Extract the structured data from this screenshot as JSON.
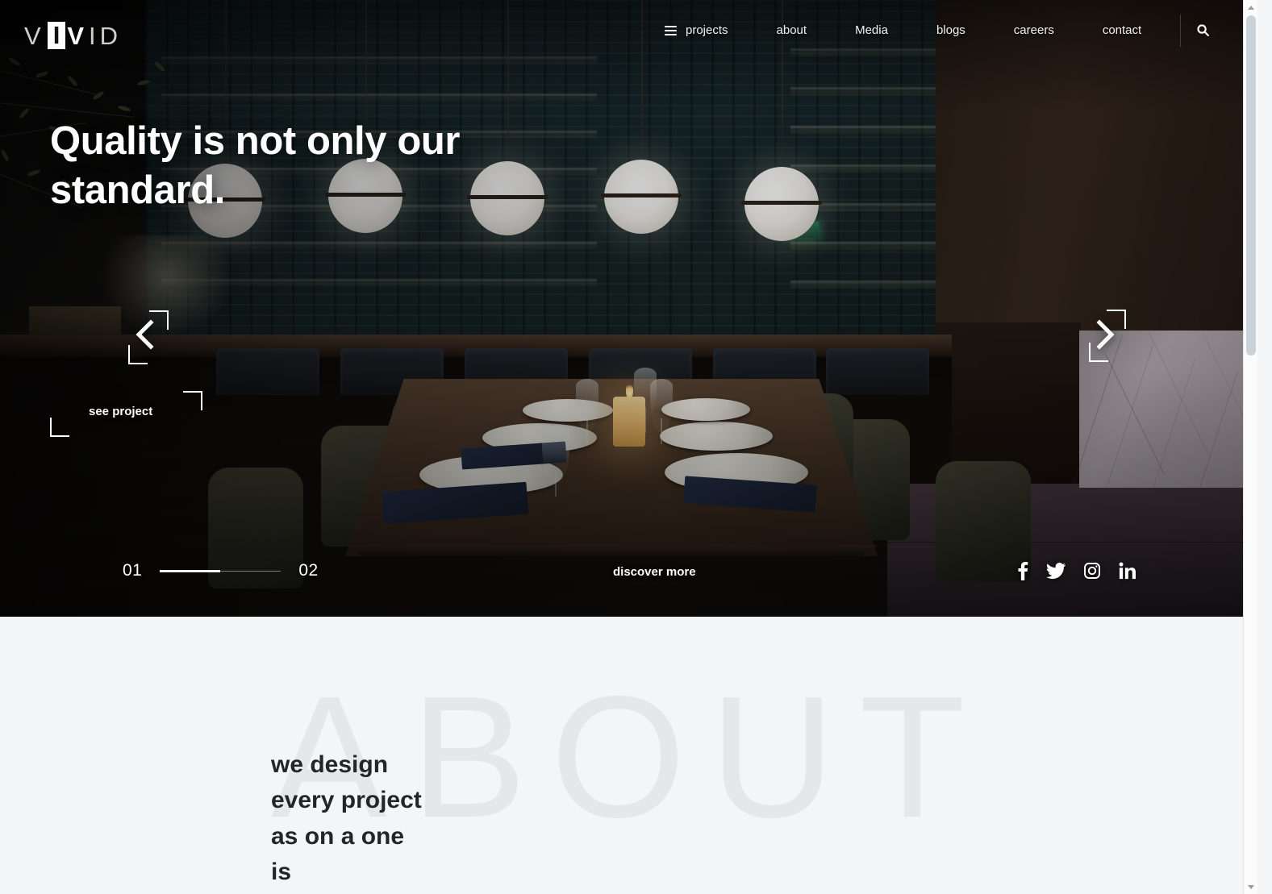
{
  "brand": {
    "logo_v1": "V",
    "logo_i": "I",
    "logo_v2": "V",
    "logo_i2": "I",
    "logo_d": "D",
    "full": "VIVID"
  },
  "nav": {
    "items": [
      {
        "label": "projects",
        "icon": "hamburger-menu-icon"
      },
      {
        "label": "about"
      },
      {
        "label": "Media"
      },
      {
        "label": "blogs"
      },
      {
        "label": "careers"
      },
      {
        "label": "contact"
      }
    ],
    "search_icon": "search-icon"
  },
  "hero": {
    "title": "Quality is not only our standard.",
    "see_project_label": "see project",
    "discover_more_label": "discover more",
    "prev_arrow_icon": "chevron-left-icon",
    "next_arrow_icon": "chevron-right-icon",
    "slider": {
      "current": "01",
      "total": "02",
      "progress_percent": 50
    },
    "socials": [
      {
        "name": "facebook-icon",
        "label": "Facebook"
      },
      {
        "name": "twitter-icon",
        "label": "Twitter"
      },
      {
        "name": "instagram-icon",
        "label": "Instagram"
      },
      {
        "name": "linkedin-icon",
        "label": "LinkedIn"
      }
    ],
    "image_alt": "Dark upscale restaurant interior with bar shelving, globe pendant lights and a set dining table"
  },
  "about": {
    "watermark": "ABOUT",
    "copy": "we design every project as on a one is"
  },
  "colors": {
    "page_background": "#f4f5f6",
    "hero_background": "#0a0908",
    "text_light": "#ffffff",
    "text_dark": "#22262b",
    "watermark": "#e6e7e8",
    "scrollbar_thumb": "#c9d2d8"
  },
  "scrollbar": {
    "up_arrow": "scroll-up-arrow",
    "down_arrow": "scroll-down-arrow"
  }
}
